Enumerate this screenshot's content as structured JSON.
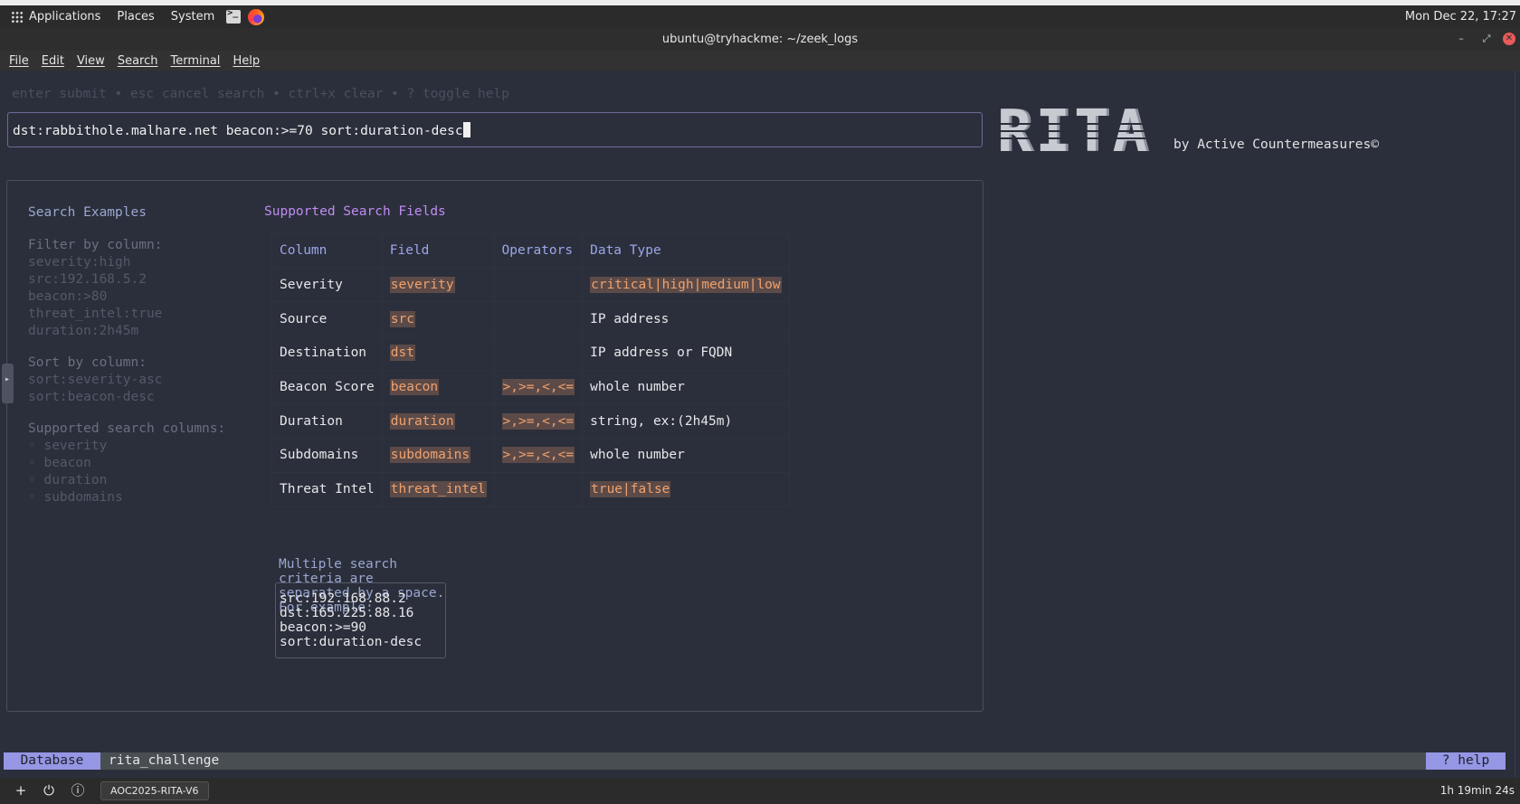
{
  "desktop": {
    "menus": [
      "Applications",
      "Places",
      "System"
    ],
    "clock": "Mon Dec 22, 17:27"
  },
  "window": {
    "title": "ubuntu@tryhackme: ~/zeek_logs",
    "menu": [
      "File",
      "Edit",
      "View",
      "Search",
      "Terminal",
      "Help"
    ]
  },
  "tui": {
    "hint": "enter submit • esc cancel search • ctrl+x clear • ? toggle help",
    "search_value": "dst:rabbithole.malhare.net beacon:>=70 sort:duration-desc",
    "logo_text": "RITA",
    "byline": "by Active Countermeasures©",
    "examples": {
      "title": "Search Examples",
      "filter_head": "Filter by column:",
      "filter_items": [
        "severity:high",
        "src:192.168.5.2",
        "beacon:>80",
        "threat_intel:true",
        "duration:2h45m"
      ],
      "sort_head": "Sort by column:",
      "sort_items": [
        "sort:severity-asc",
        "sort:beacon-desc"
      ],
      "columns_head": "Supported search columns:",
      "columns_items": [
        "◦ severity",
        "◦ beacon",
        "◦ duration",
        "◦ subdomains"
      ]
    },
    "fields": {
      "title": "Supported Search Fields",
      "headers": [
        "Column",
        "Field",
        "Operators",
        "Data Type"
      ],
      "rows": [
        {
          "column": "Severity",
          "field": "severity",
          "operators": "",
          "type": "critical|high|medium|low"
        },
        {
          "column": "Source",
          "field": "src",
          "operators": "",
          "type": "IP address"
        },
        {
          "column": "Destination",
          "field": "dst",
          "operators": "",
          "type": "IP address or FQDN"
        },
        {
          "column": "Beacon Score",
          "field": "beacon",
          "operators": ">,>=,<,<=",
          "type": "whole number"
        },
        {
          "column": "Duration",
          "field": "duration",
          "operators": ">,>=,<,<=",
          "type": "string, ex:(2h45m)"
        },
        {
          "column": "Subdomains",
          "field": "subdomains",
          "operators": ">,>=,<,<=",
          "type": "whole number"
        },
        {
          "column": "Threat Intel",
          "field": "threat_intel",
          "operators": "",
          "type": "true|false"
        }
      ],
      "example_label": "Multiple search criteria are separated by a space. For example:",
      "example_value": "src:192.168.88.2 dst:165.225.88.16 beacon:>=90 sort:duration-desc"
    },
    "status": {
      "label": "Database",
      "value": "rita_challenge",
      "help": "? help"
    }
  },
  "taskbar": {
    "task": "AOC2025-RITA-V6",
    "uptime": "1h 19min 24s"
  }
}
